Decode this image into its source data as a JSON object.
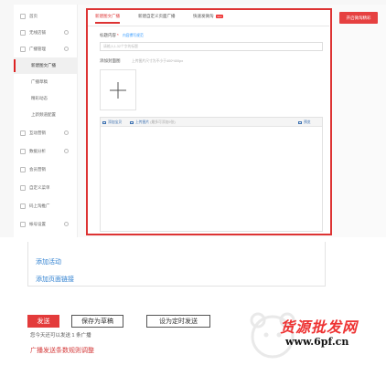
{
  "sidebar": {
    "items": [
      {
        "label": "首页"
      },
      {
        "label": "无线店铺"
      },
      {
        "label": "广播管理"
      },
      {
        "label": "新建图文广播"
      },
      {
        "label": "广播草稿"
      },
      {
        "label": "精彩动态"
      },
      {
        "label": "上新频道配置"
      },
      {
        "label": "互动营销"
      },
      {
        "label": "数据分析"
      },
      {
        "label": "会员营销"
      },
      {
        "label": "自定义菜单"
      },
      {
        "label": "码上淘推广"
      },
      {
        "label": "帐号设置"
      }
    ]
  },
  "tabs": [
    {
      "label": "新建图文广播"
    },
    {
      "label": "新建自定义页面广播"
    },
    {
      "label": "快速发微淘",
      "badge": "new"
    }
  ],
  "header_button": "开启微淘精彩",
  "form": {
    "title_label": "标题内容",
    "title_hint": "内容撰写规范",
    "title_placeholder": "请输入1-32个字的标题",
    "cover_label": "添加封面图",
    "cover_hint": "上传图片尺寸为不小于400*400px",
    "editor_tools": {
      "add_product": "添加宝贝",
      "upload_image": "上传图片",
      "image_limit": "(最多可添加9张)",
      "preview": "预览"
    }
  },
  "bottom": {
    "add_activity": "添加活动",
    "add_page_link": "添加页面链接",
    "send_button": "发送",
    "save_draft_button": "保存为草稿",
    "schedule_button": "设为定时发送",
    "remaining_tip": "您今天还可以发送 1 条广播",
    "rule_link": "广播发送条数规则调整"
  },
  "watermark": {
    "text": "货源批发网",
    "url": "www.6pf.cn"
  },
  "colors": {
    "accent_red": "#e33b3b",
    "link_blue": "#2d7fd0"
  }
}
